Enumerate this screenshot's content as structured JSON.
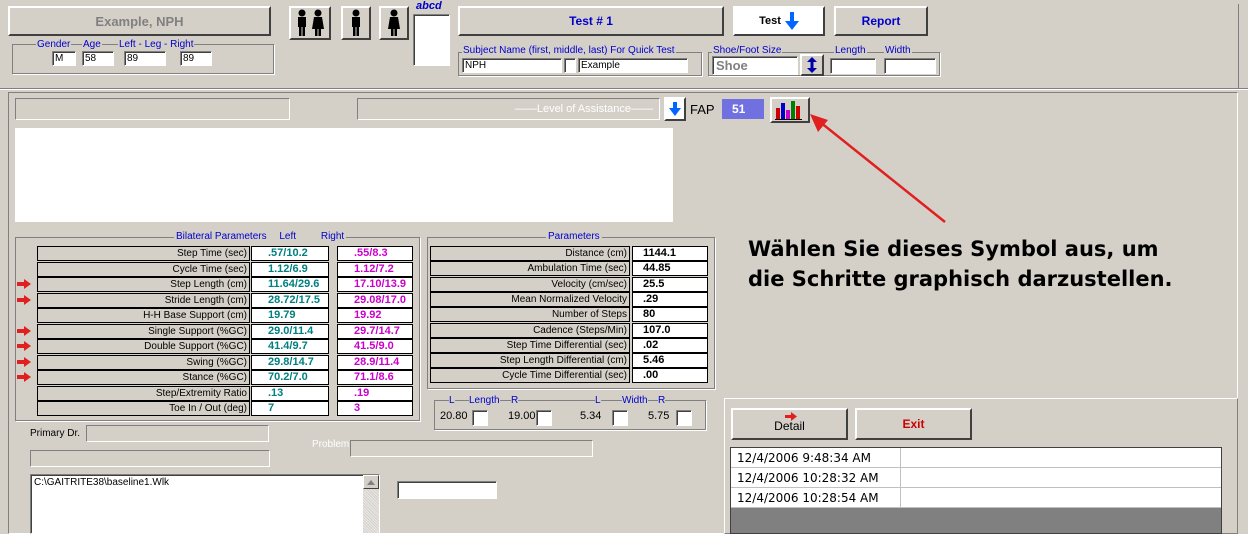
{
  "header": {
    "patient_name": "Example, NPH",
    "test_label": "Test # 1",
    "test_dropdown_label": "Test",
    "report_label": "Report",
    "abcd_label": "abcd",
    "gender_label": "Gender",
    "age_label": "Age",
    "leg_label": "Left - Leg - Right",
    "gender_value": "M",
    "age_value": "58",
    "leg_left_value": "89",
    "leg_right_value": "89",
    "subject_label": "Subject Name (first, middle, last) For Quick Test",
    "subject_first": "NPH",
    "subject_middle": "",
    "subject_last": "Example",
    "shoe_label": "Shoe/Foot Size",
    "shoe_value": "Shoe",
    "length_label": "Length",
    "width_label": "Width",
    "length_value": "",
    "width_value": ""
  },
  "assist": {
    "level_label": "Level of Assistance",
    "fap_label": "FAP",
    "fap_value": "51"
  },
  "annotation": {
    "line1": "Wählen Sie dieses Symbol aus, um",
    "line2": "die Schritte graphisch darzustellen."
  },
  "bilateral": {
    "title": "Bilateral Parameters",
    "left_header": "Left",
    "right_header": "Right",
    "rows": [
      {
        "label": "Step Time (sec)",
        "left": ".57/10.2",
        "right": ".55/8.3",
        "flag": false
      },
      {
        "label": "Cycle Time (sec)",
        "left": "1.12/6.9",
        "right": "1.12/7.2",
        "flag": false
      },
      {
        "label": "Step Length (cm)",
        "left": "11.64/29.6",
        "right": "17.10/13.9",
        "flag": true
      },
      {
        "label": "Stride Length (cm)",
        "left": "28.72/17.5",
        "right": "29.08/17.0",
        "flag": true
      },
      {
        "label": "H-H Base Support (cm)",
        "left": "19.79",
        "right": "19.92",
        "flag": false
      },
      {
        "label": "Single Support (%GC)",
        "left": "29.0/11.4",
        "right": "29.7/14.7",
        "flag": true
      },
      {
        "label": "Double Support (%GC)",
        "left": "41.4/9.7",
        "right": "41.5/9.0",
        "flag": true
      },
      {
        "label": "Swing (%GC)",
        "left": "29.8/14.7",
        "right": "28.9/11.4",
        "flag": true
      },
      {
        "label": "Stance (%GC)",
        "left": "70.2/7.0",
        "right": "71.1/8.6",
        "flag": true
      },
      {
        "label": "Step/Extremity Ratio",
        "left": ".13",
        "right": ".19",
        "flag": false
      },
      {
        "label": "Toe In / Out (deg)",
        "left": "7",
        "right": "3",
        "flag": false
      }
    ]
  },
  "parameters": {
    "title": "Parameters",
    "rows": [
      {
        "label": "Distance (cm)",
        "value": "1144.1"
      },
      {
        "label": "Ambulation Time (sec)",
        "value": "44.85"
      },
      {
        "label": "Velocity (cm/sec)",
        "value": "25.5"
      },
      {
        "label": "Mean Normalized Velocity",
        "value": ".29"
      },
      {
        "label": "Number of Steps",
        "value": "80"
      },
      {
        "label": "Cadence (Steps/Min)",
        "value": "107.0"
      },
      {
        "label": "Step Time Differential (sec)",
        "value": ".02"
      },
      {
        "label": "Step Length Differential (cm)",
        "value": "5.46"
      },
      {
        "label": "Cycle Time Differential (sec)",
        "value": ".00"
      }
    ]
  },
  "foot": {
    "l_label": "L",
    "length_label": "Length",
    "r_label": "R",
    "width_label": "Width",
    "length_l": "20.80",
    "length_r": "19.00",
    "width_l": "5.34",
    "width_r": "5.75"
  },
  "bottom": {
    "primary_dr_label": "Primary Dr.",
    "problem_label": "Problem",
    "file_path": "C:\\GAITRITE38\\baseline1.Wlk"
  },
  "right_panel": {
    "detail_label": "Detail",
    "exit_label": "Exit",
    "tests": [
      "12/4/2006 9:48:34 AM",
      "12/4/2006 10:28:32 AM",
      "12/4/2006 10:28:54 AM"
    ]
  },
  "colors": {
    "teal": "#008080",
    "magenta": "#cc00cc",
    "annotation_red": "#e02020",
    "fap_bg": "#7070e0"
  }
}
